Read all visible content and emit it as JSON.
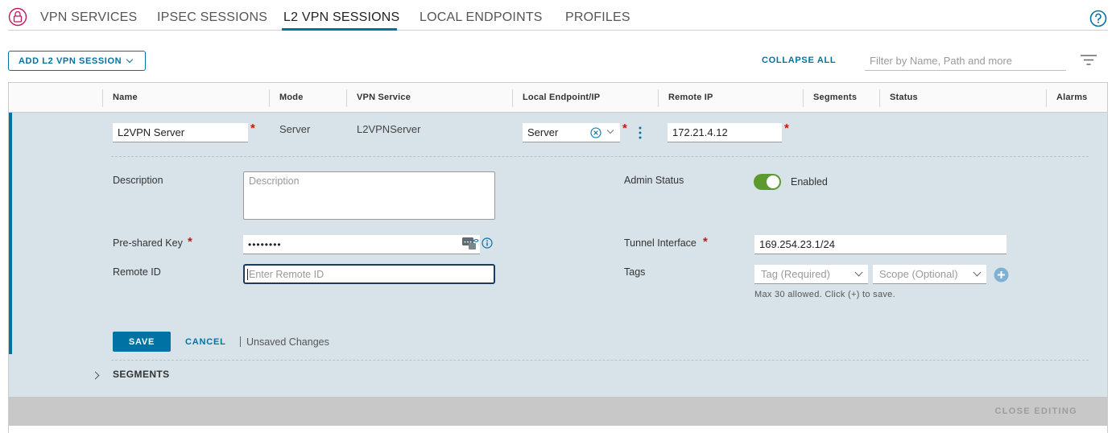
{
  "tabs": [
    "VPN SERVICES",
    "IPSEC SESSIONS",
    "L2 VPN SESSIONS",
    "LOCAL ENDPOINTS",
    "PROFILES"
  ],
  "active_tab": "L2 VPN SESSIONS",
  "toolbar": {
    "add_label": "ADD L2 VPN SESSION",
    "collapse_label": "COLLAPSE ALL",
    "filter_placeholder": "Filter by Name, Path and more"
  },
  "columns": [
    "Name",
    "Mode",
    "VPN Service",
    "Local Endpoint/IP",
    "Remote IP",
    "Segments",
    "Status",
    "Alarms"
  ],
  "row": {
    "name": "L2VPN Server",
    "mode": "Server",
    "vpn_service": "L2VPNServer",
    "local_endpoint": "Server",
    "remote_ip": "172.21.4.12"
  },
  "form": {
    "description_label": "Description",
    "description_placeholder": "Description",
    "psk_label": "Pre-shared Key",
    "psk_value": "••••••••",
    "remote_id_label": "Remote ID",
    "remote_id_placeholder": "Enter Remote ID",
    "admin_status_label": "Admin Status",
    "admin_status_value": "Enabled",
    "admin_status_on": true,
    "tunnel_label": "Tunnel Interface",
    "tunnel_value": "169.254.23.1/24",
    "tags_label": "Tags",
    "tag_placeholder": "Tag (Required)",
    "scope_placeholder": "Scope (Optional)",
    "tags_helper": "Max 30 allowed. Click (+) to save."
  },
  "actions": {
    "save": "SAVE",
    "cancel": "CANCEL",
    "unsaved": "Unsaved Changes",
    "segments": "SEGMENTS",
    "close_editing": "CLOSE EDITING"
  },
  "colors": {
    "accent": "#0072a3",
    "required": "#c21d00",
    "toggle_on": "#5a9a2f",
    "edit_bg": "#d8e3e9"
  }
}
